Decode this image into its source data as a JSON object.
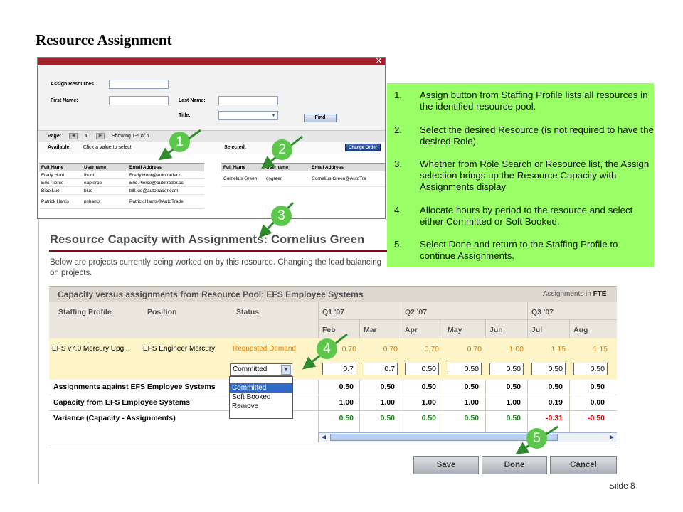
{
  "slide": {
    "title": "Resource Assignment",
    "number": "Slide 8"
  },
  "assign_window": {
    "close_glyph": "✕",
    "labels": {
      "assign_resources": "Assign Resources",
      "first_name": "First Name:",
      "last_name": "Last Name:",
      "title": "Title:"
    },
    "find_button": "Find",
    "pager": {
      "page_label": "Page:",
      "page_number": "1",
      "showing": "Showing 1-5 of 5"
    },
    "available_label": "Available:",
    "available_hint": "Click a value to select",
    "selected_label": "Selected:",
    "change_order_button": "Change Order",
    "columns": [
      "Full Name",
      "Username",
      "Email Address"
    ],
    "available_rows": [
      {
        "name": "Fredy Hunt",
        "username": "fhunt",
        "email": "Fredy.Hunt@autotrader.c"
      },
      {
        "name": "Eric Pierce",
        "username": "eapierce",
        "email": "Eric.Pierce@autotrader.cc"
      },
      {
        "name": "Biao Luo",
        "username": "bluo",
        "email": "bill.luo@autotrader.com"
      },
      {
        "name": "Patrick Harris",
        "username": "psharris",
        "email": "Patrick.Harris@AutoTrade"
      }
    ],
    "selected_rows": [
      {
        "name": "Cornelius Green",
        "username": "cngreen",
        "email": "Cornelius.Green@AutoTra"
      }
    ]
  },
  "capacity_window": {
    "title": "Resource Capacity with Assignments: Cornelius Green",
    "description": "Below are projects currently being worked on by this resource. Changing the load balancing on projects.",
    "grid_title": "Capacity versus assignments from Resource Pool: EFS Employee Systems",
    "assignments_in": "Assignments in",
    "fte": "FTE",
    "headers": {
      "staffing_profile": "Staffing Profile",
      "position": "Position",
      "status": "Status"
    },
    "quarters": [
      "Q1 '07",
      "Q2 '07",
      "Q3 '07"
    ],
    "months": [
      "Feb",
      "Mar",
      "Apr",
      "May",
      "Jun",
      "Jul",
      "Aug"
    ],
    "demand_row": {
      "staffing_profile": "EFS v7.0 Mercury Upg...",
      "position": "EFS Engineer Mercury",
      "status": "Requested Demand",
      "values": [
        "0.70",
        "0.70",
        "0.70",
        "0.70",
        "1.00",
        "1.15",
        "1.15"
      ]
    },
    "input_row": {
      "status_value": "Committed",
      "values": [
        "0.7",
        "0.7",
        "0.50",
        "0.50",
        "0.50",
        "0.50",
        "0.50"
      ]
    },
    "status_options": [
      "Committed",
      "Soft Booked",
      "Remove"
    ],
    "summary_rows": [
      {
        "label": "Assignments against EFS Employee Systems",
        "values": [
          "0.50",
          "0.50",
          "0.50",
          "0.50",
          "0.50",
          "0.50",
          "0.50"
        ]
      },
      {
        "label": "Capacity from EFS Employee Systems",
        "values": [
          "1.00",
          "1.00",
          "1.00",
          "1.00",
          "1.00",
          "0.19",
          "0.00"
        ]
      },
      {
        "label": "Variance (Capacity - Assignments)",
        "values": [
          "0.50",
          "0.50",
          "0.50",
          "0.50",
          "0.50",
          "-0.31",
          "-0.50"
        ]
      }
    ],
    "buttons": {
      "save": "Save",
      "done": "Done",
      "cancel": "Cancel"
    },
    "colors": {
      "demand_text": "#e07b00",
      "positive": "#1a8a1a",
      "negative": "#d40000",
      "accent": "#7a0f1c"
    }
  },
  "callout": {
    "items": [
      {
        "num": "1,",
        "text": "Assign button from Staffing Profile lists all resources in the identified resource pool."
      },
      {
        "num": "2.",
        "text": "Select the desired Resource (is not required to have the desired Role)."
      },
      {
        "num": "3.",
        "text": "Whether from Role Search or Resource list, the Assign selection brings up the Resource Capacity with Assignments display"
      },
      {
        "num": "4.",
        "text": "Allocate hours by period to the resource and select either Committed or Soft Booked."
      },
      {
        "num": "5.",
        "text": "Select Done and return to the Staffing Profile to continue Assignments."
      }
    ],
    "background": "#99ff66"
  },
  "markers": [
    "1",
    "2",
    "3",
    "4",
    "5"
  ]
}
